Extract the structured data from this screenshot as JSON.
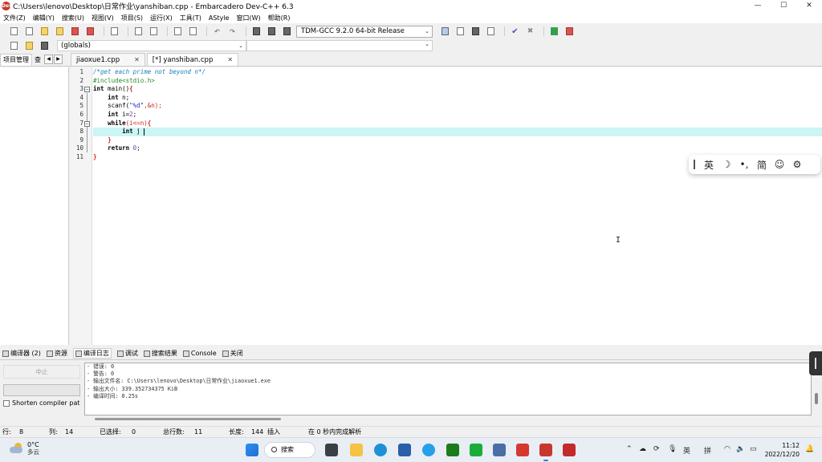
{
  "window": {
    "title": "C:\\Users\\lenovo\\Desktop\\日常作业\\yanshiban.cpp - Embarcadero Dev-C++ 6.3",
    "app_icon": "Dev"
  },
  "window_controls": {
    "minimize": "—",
    "maximize": "☐",
    "close": "✕"
  },
  "menu": [
    "文件(Z)",
    "编辑(Y)",
    "搜索(U)",
    "视图(V)",
    "项目(S)",
    "运行(X)",
    "工具(T)",
    "AStyle",
    "窗口(W)",
    "帮助(R)"
  ],
  "toolbar": {
    "compiler": "TDM-GCC 9.2.0 64-bit Release",
    "globals": "(globals)"
  },
  "left_panel": {
    "tabs": [
      "项目管理",
      "查"
    ],
    "nav_prev": "◀",
    "nav_next": "▶"
  },
  "editor_tabs": [
    {
      "label": "jiaoxue1.cpp",
      "close": "✕"
    },
    {
      "label": "[*] yanshiban.cpp",
      "close": "✕"
    }
  ],
  "editor": {
    "line_numbers": [
      "1",
      "2",
      "3",
      "4",
      "5",
      "6",
      "7",
      "8",
      "9",
      "10",
      "11"
    ],
    "fold_markers": {
      "l3": "−",
      "l7": "−"
    },
    "lines": {
      "l1": "/*get each prime not beyond n*/",
      "l2": "#include<stdio.h>",
      "l3_kw": "int",
      "l3_rest": " main()",
      "l3_brace": "{",
      "l4_indent": "    ",
      "l4_kw": "int",
      "l4_rest": " n;",
      "l5_indent": "    ",
      "l5_a": "scanf(",
      "l5_str": "\"%d\"",
      "l5_b": ",&n);",
      "l6_indent": "    ",
      "l6_kw": "int",
      "l6_a": " i=",
      "l6_num": "2",
      "l6_b": ";",
      "l7_indent": "    ",
      "l7_kw": "while",
      "l7_a": "(i<=n)",
      "l7_brace": "{",
      "l8_indent": "        ",
      "l8_kw": "int",
      "l8_rest": " j",
      "l9_indent": "    ",
      "l9_brace": "}",
      "l10_indent": "    ",
      "l10_kw": "return",
      "l10_num": " 0",
      "l10_b": ";",
      "l11_brace": "}"
    },
    "cursor": "I"
  },
  "ime_toolbar": {
    "items": [
      "英",
      "☽",
      "•,",
      "简",
      "☺",
      "⚙"
    ]
  },
  "bottom_tabs": [
    {
      "label": "编译器 (2)",
      "icon": "compiler-icon"
    },
    {
      "label": "资源",
      "icon": "resources-icon"
    },
    {
      "label": "编译日志",
      "icon": "compile-log-icon"
    },
    {
      "label": "调试",
      "icon": "debug-icon"
    },
    {
      "label": "搜索结果",
      "icon": "search-results-icon"
    },
    {
      "label": "Console",
      "icon": "console-icon"
    },
    {
      "label": "关闭",
      "icon": "close-panel-icon"
    }
  ],
  "compile_panel": {
    "abort_label": "中止",
    "shorten_label": "Shorten compiler pat",
    "log": [
      "- 错误: 0",
      "- 警告: 0",
      "- 输出文件名: C:\\Users\\lenovo\\Desktop\\日常作业\\jiaoxue1.exe",
      "- 输出大小: 339.352734375 KiB",
      "- 编译时间: 0.25s"
    ]
  },
  "statusbar": {
    "row_label": "行:",
    "row_value": "8",
    "col_label": "列:",
    "col_value": "14",
    "sel_label": "已选择:",
    "sel_value": "0",
    "total_label": "总行数:",
    "total_value": "11",
    "length_label": "长度:",
    "length_value": "144",
    "mode": "插入",
    "parse_msg": "在 0 秒内完成解析"
  },
  "taskbar": {
    "weather_temp": "0°C",
    "weather_desc": "多云",
    "search_label": "搜索",
    "tray": {
      "chevron": "⌃",
      "ime_lang": "英",
      "ime_mode": "拼"
    },
    "clock_time": "11:12",
    "clock_date": "2022/12/20"
  },
  "colors": {
    "current_line": "#ccf5f5",
    "comment": "#1d7fbf",
    "preprocessor": "#2a8a2a",
    "brace": "#d02020",
    "string": "#2233cc"
  }
}
